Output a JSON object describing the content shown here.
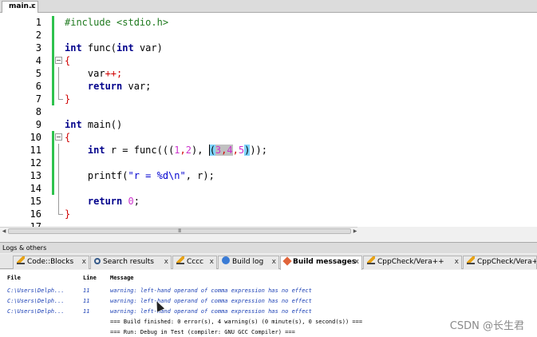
{
  "editor": {
    "file_tab": "main.c",
    "file_tab_close": "x",
    "line_numbers": [
      "1",
      "2",
      "3",
      "4",
      "5",
      "6",
      "7",
      "8",
      "9",
      "10",
      "11",
      "12",
      "13",
      "14",
      "15",
      "16",
      "17"
    ]
  },
  "code": {
    "l1": "#include <stdio.h>",
    "l3_kw": "int",
    "l3_mid": " func(",
    "l3_kw2": "int",
    "l3_end": " var)",
    "l4": "{",
    "l5_a": "    var",
    "l5_op": "++;",
    "l6_kw": "return",
    "l6_end": " var;",
    "l7": "}",
    "l9_kw": "int",
    "l9_end": " main()",
    "l10": "{",
    "l11_kw": "int",
    "l11_a": " r = func(((",
    "l11_n1": "1",
    "l11_c1": ",",
    "l11_n2": "2",
    "l11_b": "), ",
    "l11_p1": "(",
    "l11_n3": "3",
    "l11_c2": ",",
    "l11_n4": "4",
    "l11_c3": ",",
    "l11_n5": "5",
    "l11_p2": ")",
    "l11_end": "));",
    "l13_a": "printf(",
    "l13_str": "\"r = %d\\n\"",
    "l13_end": ", r);",
    "l15_kw": "return",
    "l15_num": " 0",
    "l15_end": ";",
    "l16": "}"
  },
  "scrollbar": {
    "grip": "III"
  },
  "logs": {
    "header": "Logs & others",
    "tabs": [
      {
        "label": "Code::Blocks",
        "icon": "pencil-icon"
      },
      {
        "label": "Search results",
        "icon": "magnifier-icon"
      },
      {
        "label": "Cccc",
        "icon": "pencil-icon"
      },
      {
        "label": "Build log",
        "icon": "build-log-icon"
      },
      {
        "label": "Build messages",
        "icon": "build-messages-icon"
      },
      {
        "label": "CppCheck/Vera++",
        "icon": "pencil-icon"
      },
      {
        "label": "CppCheck/Vera++",
        "icon": "pencil-icon"
      }
    ],
    "tab_close": "x",
    "columns": {
      "file": "File",
      "line": "Line",
      "message": "Message"
    },
    "rows": [
      {
        "file": "C:\\Users\\Delph...",
        "line": "11",
        "message": "warning: left-hand operand of comma expression has no effect"
      },
      {
        "file": "C:\\Users\\Delph...",
        "line": "11",
        "message": "warning: left-hand operand of comma expression has no effect"
      },
      {
        "file": "C:\\Users\\Delph...",
        "line": "11",
        "message": "warning: left-hand operand of comma expression has no effect"
      },
      {
        "file": "",
        "line": "",
        "message": "=== Build finished: 0 error(s), 4 warning(s) (0 minute(s), 0 second(s)) ==="
      },
      {
        "file": "",
        "line": "",
        "message": "=== Run: Debug in Test (compiler: GNU GCC Compiler) ==="
      }
    ]
  },
  "watermark": "CSDN @长生君",
  "colors": {
    "keyword": "#00008b",
    "preprocessor": "#1f7a1f",
    "operator": "#d00000",
    "number": "#cc33cc",
    "string": "#0000d0",
    "change_bar": "#2ec24d",
    "warning_text": "#1a3fb5"
  }
}
